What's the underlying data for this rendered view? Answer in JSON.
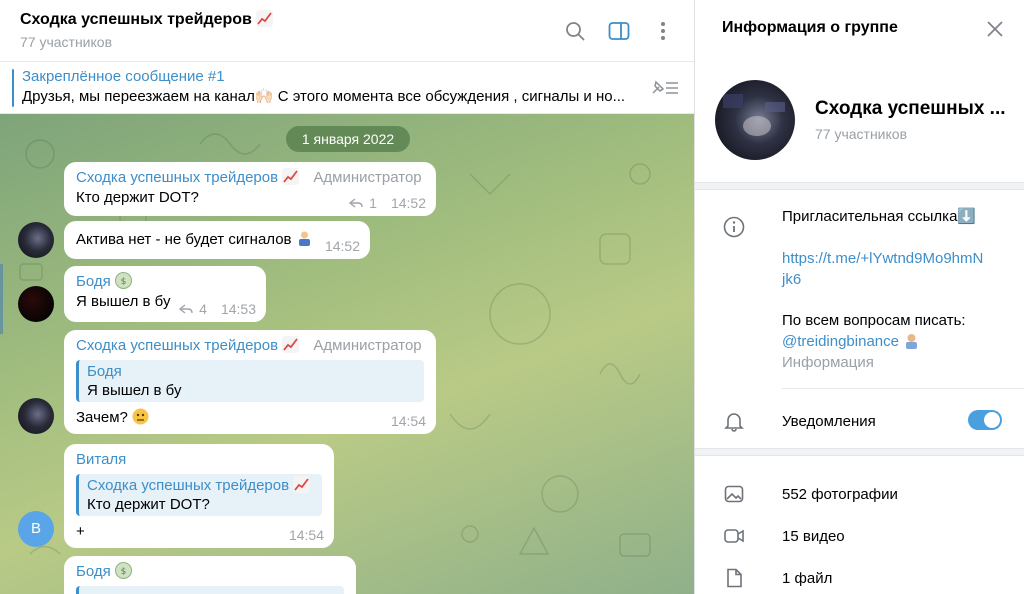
{
  "chat": {
    "title": "Сходка успешных трейдеров",
    "subtitle": "77 участников",
    "pinned": {
      "title": "Закреплённое сообщение #1",
      "text": "Друзья, мы переезжаем на канал🙌🏻 С этого момента все обсуждения , сигналы и но..."
    },
    "date": "1 января 2022",
    "messages": [
      {
        "name": "Сходка успешных трейдеров",
        "role": "Администратор",
        "text": "Кто держит DOT?",
        "replies": "1",
        "time": "14:52"
      },
      {
        "text": "Актива нет - не будет сигналов",
        "time": "14:52"
      },
      {
        "name": "Бодя",
        "text": "Я вышел в бу",
        "replies": "4",
        "time": "14:53"
      },
      {
        "name": "Сходка успешных трейдеров",
        "role": "Администратор",
        "quote_name": "Бодя",
        "quote_text": "Я вышел в бу",
        "text": "Зачем?",
        "time": "14:54"
      },
      {
        "name": "Виталя",
        "quote_name": "Сходка успешных трейдеров",
        "quote_text": "Кто держит DOT?",
        "text": "+",
        "time": "14:54",
        "avatar_letter": "В"
      },
      {
        "name": "Бодя"
      }
    ]
  },
  "info": {
    "header": "Информация о группе",
    "name": "Сходка успешных ...",
    "members": "77 участников",
    "invite_label": "Пригласительная ссылка⬇️",
    "invite_link_line1": "https://t.me/+lYwtnd9Mo9hmN",
    "invite_link_line2": "jk6",
    "contact_text": "По всем вопросам писать:",
    "contact_handle": "@treidingbinance",
    "contact_caption": "Информация",
    "notifications_label": "Уведомления",
    "notifications_on": true,
    "photos": "552 фотографии",
    "videos": "15 видео",
    "files": "1 файл"
  },
  "colors": {
    "accent": "#3d8ec9",
    "toggle": "#4a9fde",
    "chart_emoji": "#e04848"
  },
  "icons": [
    "search-icon",
    "sidebar-toggle-icon",
    "more-vertical-icon",
    "pin-list-icon",
    "close-icon",
    "info-icon",
    "bell-icon",
    "photo-icon",
    "video-icon",
    "file-icon",
    "reply-arrow-icon"
  ]
}
